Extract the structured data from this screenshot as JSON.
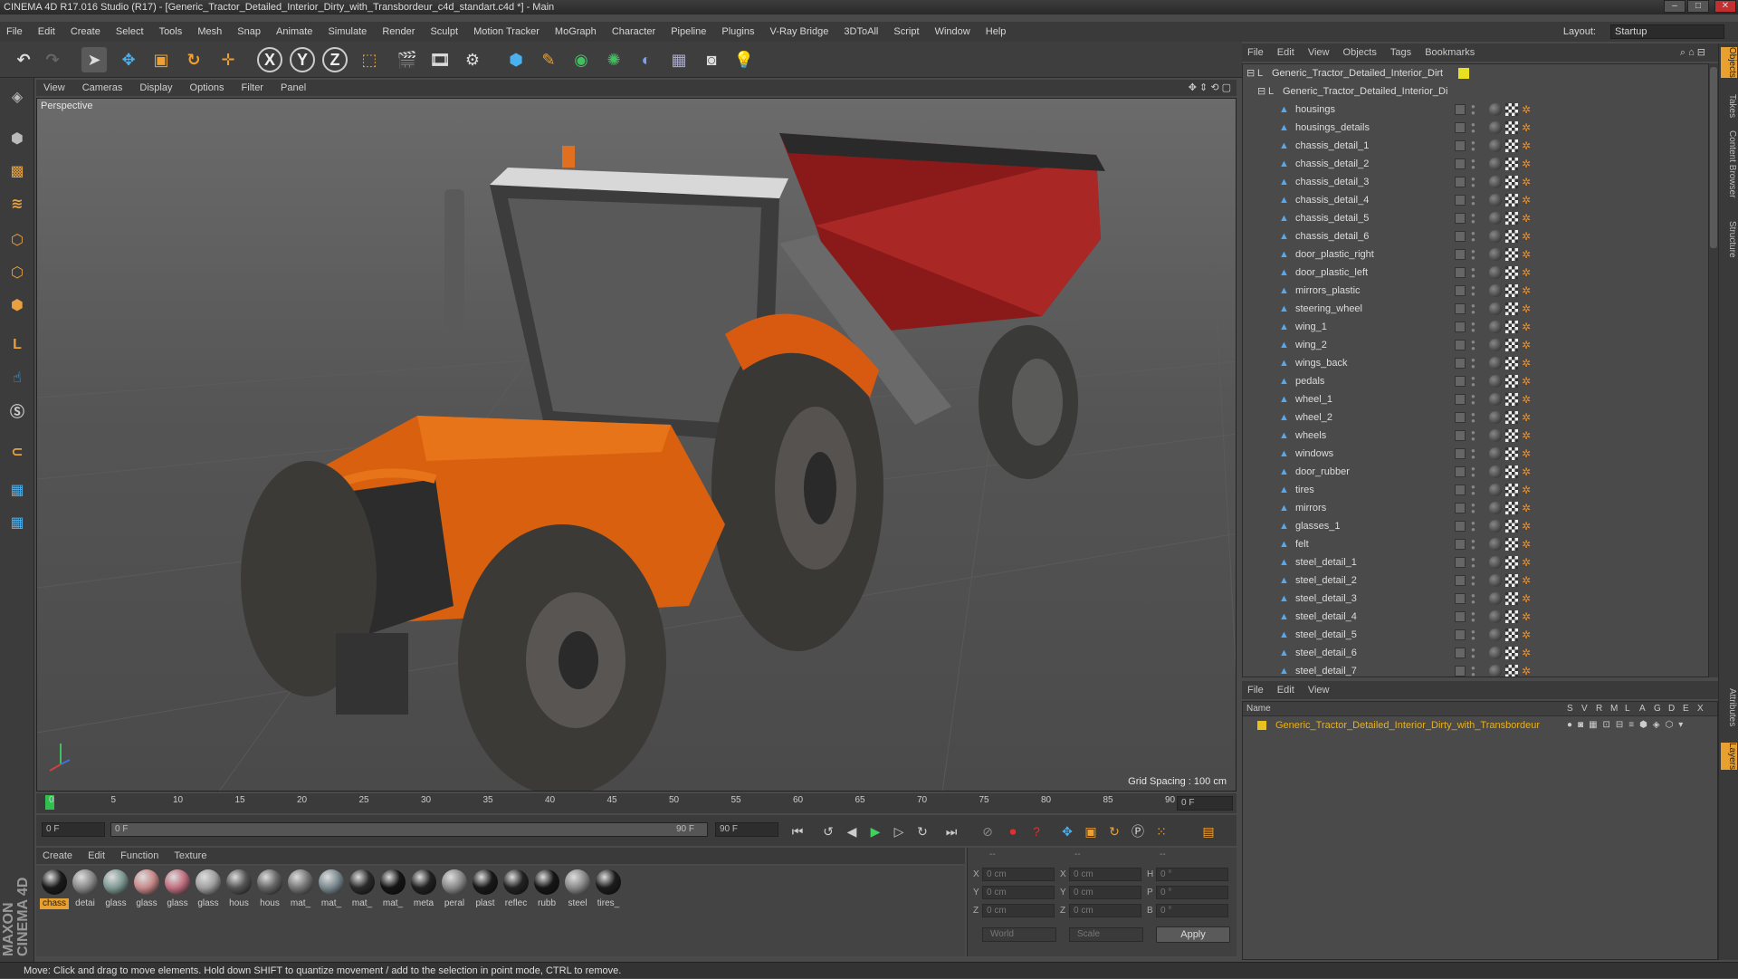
{
  "window": {
    "title": "CINEMA 4D R17.016 Studio (R17) - [Generic_Tractor_Detailed_Interior_Dirty_with_Transbordeur_c4d_standart.c4d *] - Main",
    "minimize": "–",
    "maximize": "□",
    "close": "✕"
  },
  "menubar": {
    "items": [
      "File",
      "Edit",
      "Create",
      "Select",
      "Tools",
      "Mesh",
      "Snap",
      "Animate",
      "Simulate",
      "Render",
      "Sculpt",
      "Motion Tracker",
      "MoGraph",
      "Character",
      "Pipeline",
      "Plugins",
      "V-Ray Bridge",
      "3DToAll",
      "Script",
      "Window",
      "Help"
    ],
    "layout_label": "Layout:",
    "layout_value": "Startup"
  },
  "toolbar": {
    "icons": [
      "undo-icon",
      "redo-icon",
      "select-arrow-icon",
      "move-icon",
      "scale-icon",
      "rotate-icon",
      "last-tool-icon",
      "x-axis-icon",
      "y-axis-icon",
      "z-axis-icon",
      "coordinate-system-icon",
      "render-view-icon",
      "render-picture-viewer-icon",
      "render-settings-icon",
      "cube-primitive-icon",
      "spline-pen-icon",
      "nurbs-icon",
      "array-icon",
      "deformer-icon",
      "floor-icon",
      "camera-icon",
      "light-icon"
    ],
    "x_label": "X",
    "y_label": "Y",
    "z_label": "Z"
  },
  "viewport": {
    "menu": [
      "View",
      "Cameras",
      "Display",
      "Options",
      "Filter",
      "Panel"
    ],
    "label": "Perspective",
    "grid_spacing": "Grid Spacing : 100 cm"
  },
  "timeline": {
    "ticks": [
      "0",
      "5",
      "10",
      "15",
      "20",
      "25",
      "30",
      "35",
      "40",
      "45",
      "50",
      "55",
      "60",
      "65",
      "70",
      "75",
      "80",
      "85",
      "90"
    ],
    "current_frame": "0 F",
    "start_frame": "0 F",
    "range_start": "0 F",
    "range_end": "90 F",
    "end_frame": "90 F"
  },
  "materials": {
    "menu": [
      "Create",
      "Edit",
      "Function",
      "Texture"
    ],
    "items": [
      {
        "label": "chass",
        "color": "#1a1a1a"
      },
      {
        "label": "detai",
        "color": "#8a8a8a"
      },
      {
        "label": "glass",
        "color": "#7f9a94"
      },
      {
        "label": "glass",
        "color": "#c88a8a"
      },
      {
        "label": "glass",
        "color": "#c07080"
      },
      {
        "label": "glass",
        "color": "#a0a0a0"
      },
      {
        "label": "hous",
        "color": "#555"
      },
      {
        "label": "hous",
        "color": "#666"
      },
      {
        "label": "mat_",
        "color": "#777"
      },
      {
        "label": "mat_",
        "color": "#7a8a90"
      },
      {
        "label": "mat_",
        "color": "#2a2a2a"
      },
      {
        "label": "mat_",
        "color": "#141414"
      },
      {
        "label": "meta",
        "color": "#202020"
      },
      {
        "label": "peral",
        "color": "#8a8a8a"
      },
      {
        "label": "plast",
        "color": "#181818"
      },
      {
        "label": "reflec",
        "color": "#222"
      },
      {
        "label": "rubb",
        "color": "#161616"
      },
      {
        "label": "steel",
        "color": "#8a8a8a"
      },
      {
        "label": "tires_",
        "color": "#1c1c1c"
      }
    ]
  },
  "coords": {
    "headers": [
      "--",
      "--",
      "--"
    ],
    "rows": [
      {
        "a": "X",
        "v1": "0 cm",
        "b": "X",
        "v2": "0 cm",
        "c": "H",
        "v3": "0 °"
      },
      {
        "a": "Y",
        "v1": "0 cm",
        "b": "Y",
        "v2": "0 cm",
        "c": "P",
        "v3": "0 °"
      },
      {
        "a": "Z",
        "v1": "0 cm",
        "b": "Z",
        "v2": "0 cm",
        "c": "B",
        "v3": "0 °"
      }
    ],
    "mode": "World",
    "type": "Scale",
    "apply": "Apply"
  },
  "objects": {
    "menu": [
      "File",
      "Edit",
      "View",
      "Objects",
      "Tags",
      "Bookmarks"
    ],
    "root": "Generic_Tractor_Detailed_Interior_Dirt",
    "group": "Generic_Tractor_Detailed_Interior_Di",
    "items": [
      "housings",
      "housings_details",
      "chassis_detail_1",
      "chassis_detail_2",
      "chassis_detail_3",
      "chassis_detail_4",
      "chassis_detail_5",
      "chassis_detail_6",
      "door_plastic_right",
      "door_plastic_left",
      "mirrors_plastic",
      "steering_wheel",
      "wing_1",
      "wing_2",
      "wings_back",
      "pedals",
      "wheel_1",
      "wheel_2",
      "wheels",
      "windows",
      "door_rubber",
      "tires",
      "mirrors",
      "glasses_1",
      "felt",
      "steel_detail_1",
      "steel_detail_2",
      "steel_detail_3",
      "steel_detail_4",
      "steel_detail_5",
      "steel_detail_6",
      "steel_detail_7"
    ]
  },
  "right_tabs": [
    "Objects",
    "Takes",
    "Content Browser",
    "Structure",
    "Attributes",
    "Layers"
  ],
  "layers": {
    "menu": [
      "File",
      "Edit",
      "View"
    ],
    "name_header": "Name",
    "columns": [
      "S",
      "V",
      "R",
      "M",
      "L",
      "A",
      "G",
      "D",
      "E",
      "X"
    ],
    "row": "Generic_Tractor_Detailed_Interior_Dirty_with_Transbordeur",
    "row_color": "#e8c020"
  },
  "status": "Move: Click and drag to move elements. Hold down SHIFT to quantize movement / add to the selection in point mode, CTRL to remove.",
  "branding": "MAXON CINEMA 4D"
}
